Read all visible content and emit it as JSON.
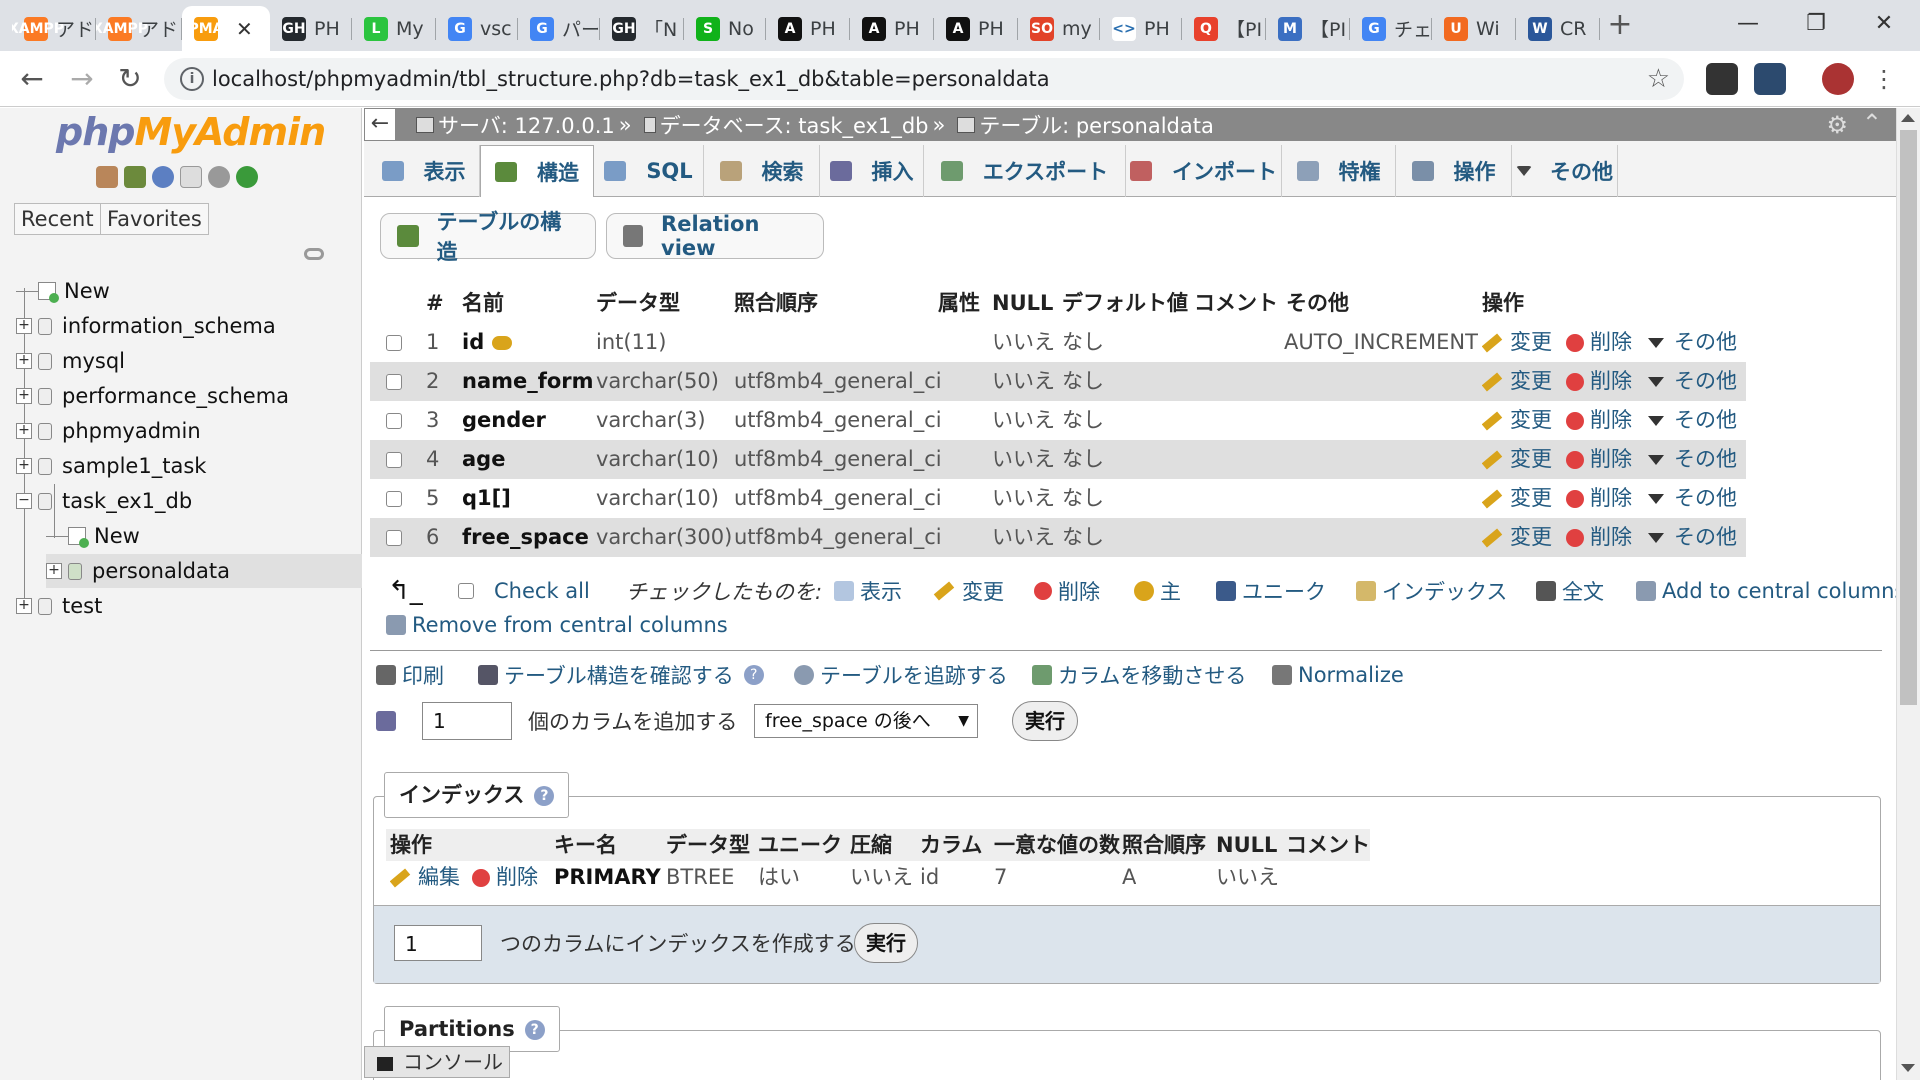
{
  "browser": {
    "tabs": [
      {
        "label": "アド",
        "fav": "XAMPP",
        "color": "#fb7a24"
      },
      {
        "label": "アド",
        "fav": "XAMPP",
        "color": "#fb7a24"
      },
      {
        "label": "",
        "fav": "PMA",
        "color": "#f89c0e",
        "active": true
      },
      {
        "label": "PH",
        "fav": "GH",
        "color": "#24292e"
      },
      {
        "label": "My",
        "fav": "L",
        "color": "#2bc43f"
      },
      {
        "label": "vsc",
        "fav": "G",
        "color": "#4285f4"
      },
      {
        "label": "パー",
        "fav": "G",
        "color": "#4285f4"
      },
      {
        "label": "「N",
        "fav": "GH",
        "color": "#24292e"
      },
      {
        "label": "No",
        "fav": "S",
        "color": "#10b21a"
      },
      {
        "label": "PH",
        "fav": "A",
        "color": "#111111"
      },
      {
        "label": "PH",
        "fav": "A",
        "color": "#111111"
      },
      {
        "label": "PH",
        "fav": "A",
        "color": "#111111"
      },
      {
        "label": "my",
        "fav": "SO",
        "color": "#e24329"
      },
      {
        "label": "PH",
        "fav": "<>",
        "color": "#ffffff"
      },
      {
        "label": "【PI",
        "fav": "Q",
        "color": "#e8412c"
      },
      {
        "label": "【PI",
        "fav": "M",
        "color": "#3b6fc2"
      },
      {
        "label": "チェ",
        "fav": "G",
        "color": "#4285f4"
      },
      {
        "label": "Wi",
        "fav": "U",
        "color": "#f26a20"
      },
      {
        "label": "CR",
        "fav": "W",
        "color": "#2b579a"
      }
    ],
    "url": "localhost/phpmyadmin/tbl_structure.php?db=task_ex1_db&table=personaldata"
  },
  "leftnav": {
    "logo_php": "php",
    "logo_myadmin": "MyAdmin",
    "tab_recent": "Recent",
    "tab_favorites": "Favorites",
    "tree": [
      {
        "label": "New",
        "level": 0,
        "type": "new"
      },
      {
        "label": "information_schema",
        "level": 0,
        "type": "db",
        "exp": "+"
      },
      {
        "label": "mysql",
        "level": 0,
        "type": "db",
        "exp": "+"
      },
      {
        "label": "performance_schema",
        "level": 0,
        "type": "db",
        "exp": "+"
      },
      {
        "label": "phpmyadmin",
        "level": 0,
        "type": "db",
        "exp": "+"
      },
      {
        "label": "sample1_task",
        "level": 0,
        "type": "db",
        "exp": "+"
      },
      {
        "label": "task_ex1_db",
        "level": 0,
        "type": "db",
        "exp": "−"
      },
      {
        "label": "New",
        "level": 1,
        "type": "new"
      },
      {
        "label": "personaldata",
        "level": 1,
        "type": "table",
        "exp": "+",
        "selected": true
      },
      {
        "label": "test",
        "level": 0,
        "type": "db",
        "exp": "+"
      }
    ]
  },
  "breadcrumb": {
    "server": "サーバ: 127.0.0.1",
    "database": "データベース: task_ex1_db",
    "table": "テーブル: personaldata",
    "sep": "»"
  },
  "menu_tabs": [
    {
      "label": "表示",
      "color": "#7a9cc6"
    },
    {
      "label": "構造",
      "color": "#5b8a3c",
      "active": true
    },
    {
      "label": "SQL",
      "color": "#7a9cc6"
    },
    {
      "label": "検索",
      "color": "#b9a27a"
    },
    {
      "label": "挿入",
      "color": "#6b6b9c"
    },
    {
      "label": "エクスポート",
      "color": "#6e9b6e"
    },
    {
      "label": "インポート",
      "color": "#c06060"
    },
    {
      "label": "特権",
      "color": "#8da0b8"
    },
    {
      "label": "操作",
      "color": "#7a8fa8"
    },
    {
      "label": "その他",
      "color": "#444444"
    }
  ],
  "sub_tabs": {
    "structure": "テーブルの構造",
    "relation": "Relation view"
  },
  "structure": {
    "headers": {
      "num": "#",
      "name": "名前",
      "type": "データ型",
      "collation": "照合順序",
      "attributes": "属性",
      "null": "NULL",
      "default": "デフォルト値",
      "comment": "コメント",
      "extra": "その他",
      "action": "操作"
    },
    "actions": {
      "change": "変更",
      "drop": "削除",
      "more": "その他"
    },
    "rows": [
      {
        "num": "1",
        "name": "id",
        "key": true,
        "type": "int(11)",
        "collation": "",
        "null": "いいえ",
        "default": "なし",
        "extra": "AUTO_INCREMENT"
      },
      {
        "num": "2",
        "name": "name_form",
        "type": "varchar(50)",
        "collation": "utf8mb4_general_ci",
        "null": "いいえ",
        "default": "なし",
        "extra": ""
      },
      {
        "num": "3",
        "name": "gender",
        "type": "varchar(3)",
        "collation": "utf8mb4_general_ci",
        "null": "いいえ",
        "default": "なし",
        "extra": ""
      },
      {
        "num": "4",
        "name": "age",
        "type": "varchar(10)",
        "collation": "utf8mb4_general_ci",
        "null": "いいえ",
        "default": "なし",
        "extra": ""
      },
      {
        "num": "5",
        "name": "q1[]",
        "type": "varchar(10)",
        "collation": "utf8mb4_general_ci",
        "null": "いいえ",
        "default": "なし",
        "extra": ""
      },
      {
        "num": "6",
        "name": "free_space",
        "type": "varchar(300)",
        "collation": "utf8mb4_general_ci",
        "null": "いいえ",
        "default": "なし",
        "extra": ""
      }
    ]
  },
  "bulk": {
    "check_all": "Check all",
    "with_selected": "チェックしたものを:",
    "browse": "表示",
    "change": "変更",
    "drop": "削除",
    "primary": "主",
    "unique": "ユニーク",
    "index": "インデックス",
    "fulltext": "全文",
    "add_central": "Add to central columns",
    "remove_central": "Remove from central columns"
  },
  "tools": {
    "print": "印刷",
    "propose": "テーブル構造を確認する",
    "track": "テーブルを追跡する",
    "move": "カラムを移動させる",
    "normalize": "Normalize"
  },
  "add_columns": {
    "count": "1",
    "label": "個のカラムを追加する",
    "position": "free_space の後へ",
    "go": "実行"
  },
  "indexes": {
    "legend": "インデックス",
    "headers": {
      "action": "操作",
      "keyname": "キー名",
      "type": "データ型",
      "unique": "ユニーク",
      "packed": "圧縮",
      "column": "カラム",
      "cardinality": "一意な値の数",
      "collation": "照合順序",
      "null": "NULL",
      "comment": "コメント"
    },
    "row": {
      "edit": "編集",
      "drop": "削除",
      "keyname": "PRIMARY",
      "type": "BTREE",
      "unique": "はい",
      "packed": "いいえ",
      "column": "id",
      "cardinality": "7",
      "collation": "A",
      "null": "いいえ",
      "comment": ""
    },
    "create_count": "1",
    "create_label": "つのカラムにインデックスを作成する",
    "go": "実行"
  },
  "partitions": {
    "legend": "Partitions"
  },
  "console": {
    "label": "コンソール"
  }
}
